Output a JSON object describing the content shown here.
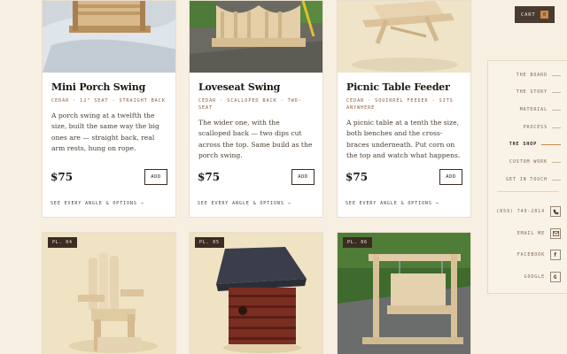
{
  "cart": {
    "label": "CART",
    "count": "0"
  },
  "products": [
    {
      "title": "Mini Porch Swing",
      "meta": "CEDAR · 12\" SEAT · STRAIGHT BACK",
      "description": "A porch swing at a twelfth the size, built the same way the big ones are — straight back, real arm rests, hung on rope.",
      "price": "$75",
      "add_label": "ADD",
      "more_label": "SEE EVERY ANGLE & OPTIONS →"
    },
    {
      "title": "Loveseat Swing",
      "meta": "CEDAR · SCALLOPED BACK · TWO-SEAT",
      "description": "The wider one, with the scalloped back — two dips cut across the top. Same build as the porch swing.",
      "price": "$75",
      "add_label": "ADD",
      "more_label": "SEE EVERY ANGLE & OPTIONS →"
    },
    {
      "title": "Picnic Table Feeder",
      "meta": "CEDAR · SQUIRREL FEEDER · SITS ANYWHERE",
      "description": "A picnic table at a tenth the size, both benches and the cross-braces underneath. Put corn on the top and watch what happens.",
      "price": "$75",
      "add_label": "ADD",
      "more_label": "SEE EVERY ANGLE & OPTIONS →"
    }
  ],
  "plates": [
    {
      "badge": "PL. 04"
    },
    {
      "badge": "PL. 05"
    },
    {
      "badge": "PL. 06"
    }
  ],
  "nav": {
    "items": [
      {
        "label": "THE BOARD"
      },
      {
        "label": "THE STORY"
      },
      {
        "label": "MATERIAL"
      },
      {
        "label": "PROCESS"
      },
      {
        "label": "THE SHOP"
      },
      {
        "label": "CUSTOM WORK"
      },
      {
        "label": "GET IN TOUCH"
      }
    ],
    "contacts": [
      {
        "label": "(859) 749-2814",
        "icon": "phone-icon"
      },
      {
        "label": "EMAIL ME",
        "icon": "mail-icon"
      },
      {
        "label": "FACEBOOK",
        "icon": "facebook-icon"
      },
      {
        "label": "GOOGLE",
        "icon": "google-icon"
      }
    ]
  },
  "colors": {
    "background": "#f7efe2",
    "accent": "#c88a4a",
    "dark": "#3b2d22"
  }
}
